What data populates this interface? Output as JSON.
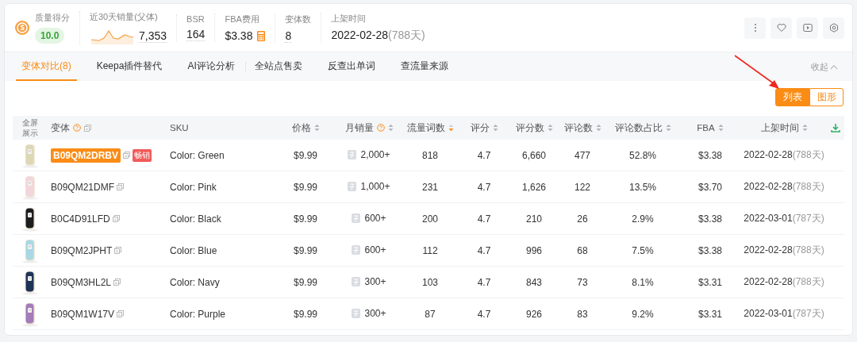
{
  "stats": [
    {
      "kind": "score",
      "label": "质量得分",
      "value": "10.0"
    },
    {
      "kind": "sparkline",
      "label": "近30天销量(父体)",
      "value": "7,353"
    },
    {
      "kind": "plain",
      "label": "BSR",
      "value": "164"
    },
    {
      "kind": "calc",
      "label": "FBA费用",
      "value": "$3.38"
    },
    {
      "kind": "plain",
      "label": "变体数",
      "value": "8"
    },
    {
      "kind": "date",
      "label": "上架时间",
      "value": "2022-02-28",
      "note": "(788天)"
    }
  ],
  "tabs": [
    {
      "label": "变体对比(8)",
      "selected": true
    },
    {
      "label": "Keepa插件替代",
      "selected": false
    },
    {
      "label": "AI评论分析",
      "selected": false
    },
    {
      "label": "全站点售卖",
      "selected": false
    },
    {
      "label": "反查出单词",
      "selected": false
    },
    {
      "label": "查流量来源",
      "selected": false
    }
  ],
  "collapse": "收起",
  "view_toggle": [
    {
      "label": "列表",
      "selected": true
    },
    {
      "label": "图形",
      "selected": false
    }
  ],
  "table": {
    "columns": [
      {
        "label": "全屏展示",
        "sortable": false,
        "help": false,
        "copy": false
      },
      {
        "label": "变体",
        "sortable": false,
        "help": true,
        "copy": true
      },
      {
        "label": "SKU",
        "sortable": false,
        "help": false,
        "copy": false
      },
      {
        "label": "价格",
        "sortable": true,
        "sorted": false,
        "help": false,
        "copy": false
      },
      {
        "label": "月销量",
        "sortable": true,
        "sorted": false,
        "help": true,
        "copy": false
      },
      {
        "label": "流量词数",
        "sortable": true,
        "sorted": true,
        "help": false,
        "copy": false
      },
      {
        "label": "评分",
        "sortable": true,
        "sorted": false,
        "help": false,
        "copy": false
      },
      {
        "label": "评分数",
        "sortable": true,
        "sorted": false,
        "help": false,
        "copy": false
      },
      {
        "label": "评论数",
        "sortable": true,
        "sorted": false,
        "help": false,
        "copy": false
      },
      {
        "label": "评论数占比",
        "sortable": true,
        "sorted": false,
        "help": false,
        "copy": false
      },
      {
        "label": "FBA",
        "sortable": true,
        "sorted": false,
        "help": false,
        "copy": false
      },
      {
        "label": "上架时间",
        "sortable": true,
        "sorted": false,
        "help": false,
        "copy": false
      }
    ],
    "rows": [
      {
        "variant": "B09QM2DRBV",
        "highlighted": true,
        "badge": "畅销",
        "sku": "Color: Green",
        "price": "$9.99",
        "monthly_sales": "2,000+",
        "traffic_words": "818",
        "rating": "4.7",
        "ratings": "6,660",
        "reviews": "477",
        "review_ratio": "52.8%",
        "fba": "$3.38",
        "date": "2022-02-28",
        "days": "(788天)"
      },
      {
        "variant": "B09QM21DMF",
        "highlighted": false,
        "sku": "Color: Pink",
        "price": "$9.99",
        "monthly_sales": "1,000+",
        "traffic_words": "231",
        "rating": "4.7",
        "ratings": "1,626",
        "reviews": "122",
        "review_ratio": "13.5%",
        "fba": "$3.70",
        "date": "2022-02-28",
        "days": "(788天)"
      },
      {
        "variant": "B0C4D91LFD",
        "highlighted": false,
        "sku": "Color: Black",
        "price": "$9.99",
        "monthly_sales": "600+",
        "traffic_words": "200",
        "rating": "4.7",
        "ratings": "210",
        "reviews": "26",
        "review_ratio": "2.9%",
        "fba": "$3.38",
        "date": "2022-03-01",
        "days": "(787天)"
      },
      {
        "variant": "B09QM2JPHT",
        "highlighted": false,
        "sku": "Color: Blue",
        "price": "$9.99",
        "monthly_sales": "600+",
        "traffic_words": "112",
        "rating": "4.7",
        "ratings": "996",
        "reviews": "68",
        "review_ratio": "7.5%",
        "fba": "$3.38",
        "date": "2022-02-28",
        "days": "(788天)"
      },
      {
        "variant": "B09QM3HL2L",
        "highlighted": false,
        "sku": "Color: Navy",
        "price": "$9.99",
        "monthly_sales": "300+",
        "traffic_words": "103",
        "rating": "4.7",
        "ratings": "843",
        "reviews": "73",
        "review_ratio": "8.1%",
        "fba": "$3.31",
        "date": "2022-02-28",
        "days": "(788天)"
      },
      {
        "variant": "B09QM1W17V",
        "highlighted": false,
        "sku": "Color: Purple",
        "price": "$9.99",
        "monthly_sales": "300+",
        "traffic_words": "87",
        "rating": "4.7",
        "ratings": "926",
        "reviews": "83",
        "review_ratio": "9.2%",
        "fba": "$3.31",
        "date": "2022-03-01",
        "days": "(787天)"
      }
    ]
  }
}
